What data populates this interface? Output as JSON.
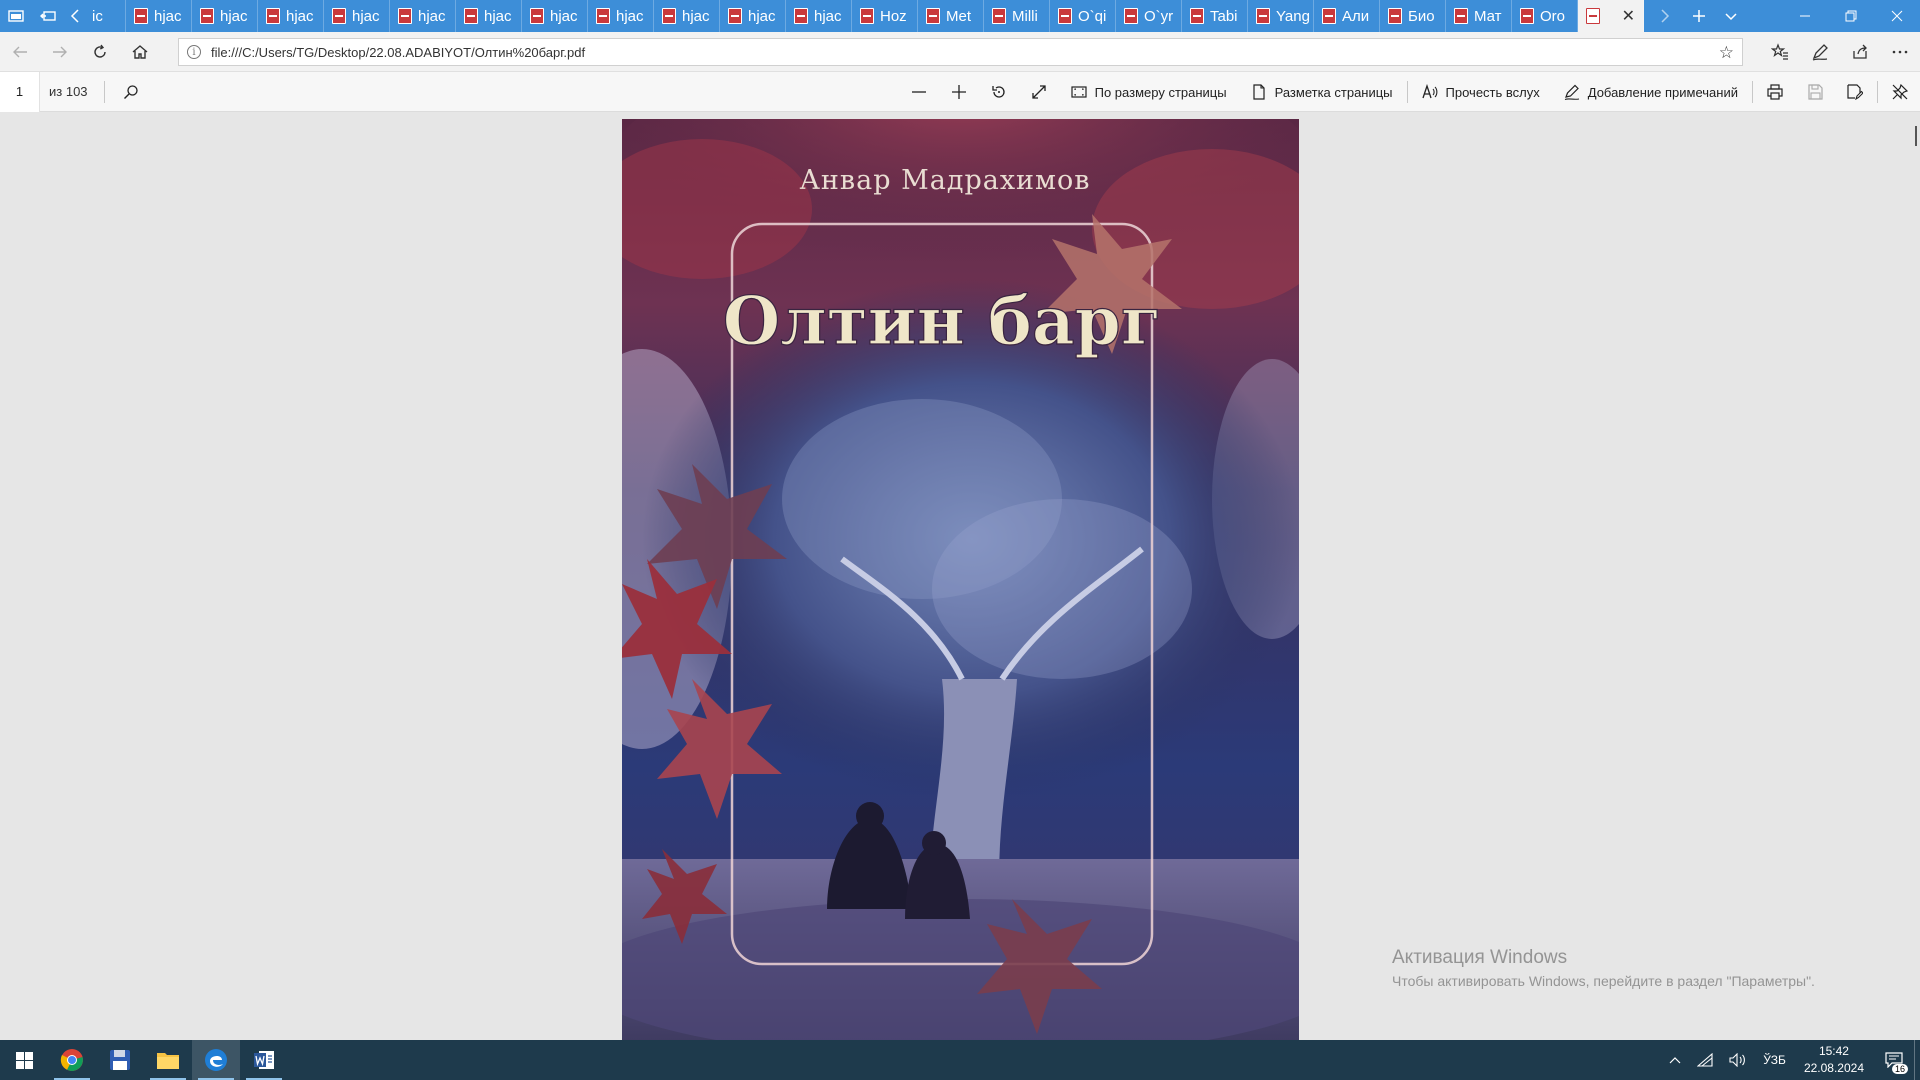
{
  "browser": {
    "tabs": [
      {
        "label": "ic",
        "active": false
      },
      {
        "label": "hjac",
        "active": false
      },
      {
        "label": "hjac",
        "active": false
      },
      {
        "label": "hjac",
        "active": false
      },
      {
        "label": "hjac",
        "active": false
      },
      {
        "label": "hjac",
        "active": false
      },
      {
        "label": "hjac",
        "active": false
      },
      {
        "label": "hjac",
        "active": false
      },
      {
        "label": "hjac",
        "active": false
      },
      {
        "label": "hjac",
        "active": false
      },
      {
        "label": "hjac",
        "active": false
      },
      {
        "label": "hjac",
        "active": false
      },
      {
        "label": "Hoz",
        "active": false
      },
      {
        "label": "Met",
        "active": false
      },
      {
        "label": "Milli",
        "active": false
      },
      {
        "label": "O`qi",
        "active": false
      },
      {
        "label": "O`yr",
        "active": false
      },
      {
        "label": "Tabi",
        "active": false
      },
      {
        "label": "Yang",
        "active": false
      },
      {
        "label": "Али",
        "active": false
      },
      {
        "label": "Био",
        "active": false
      },
      {
        "label": "Мат",
        "active": false
      },
      {
        "label": "Oro",
        "active": false
      },
      {
        "label": "",
        "active": true
      }
    ],
    "close_glyph": "✕",
    "url": "file:///C:/Users/TG/Desktop/22.08.ADABIYOT/Олтин%20барг.pdf"
  },
  "pdf_toolbar": {
    "page_current": "1",
    "page_total_label": "из 103",
    "fit_page_label": "По размеру страницы",
    "layout_label": "Разметка страницы",
    "read_aloud_label": "Прочесть вслух",
    "add_notes_label": "Добавление примечаний"
  },
  "document": {
    "author": "Анвар Мадрахимов",
    "title": "Олтин барг"
  },
  "watermark": {
    "title": "Активация Windows",
    "subtitle": "Чтобы активировать Windows, перейдите в раздел \"Параметры\"."
  },
  "taskbar": {
    "language": "ЎЗБ",
    "time": "15:42",
    "date": "22.08.2024",
    "notification_count": "16"
  },
  "colors": {
    "tabbar": "#3d8ed8",
    "taskbar": "#1e3a4c",
    "cover_title": "#efe6c8"
  }
}
